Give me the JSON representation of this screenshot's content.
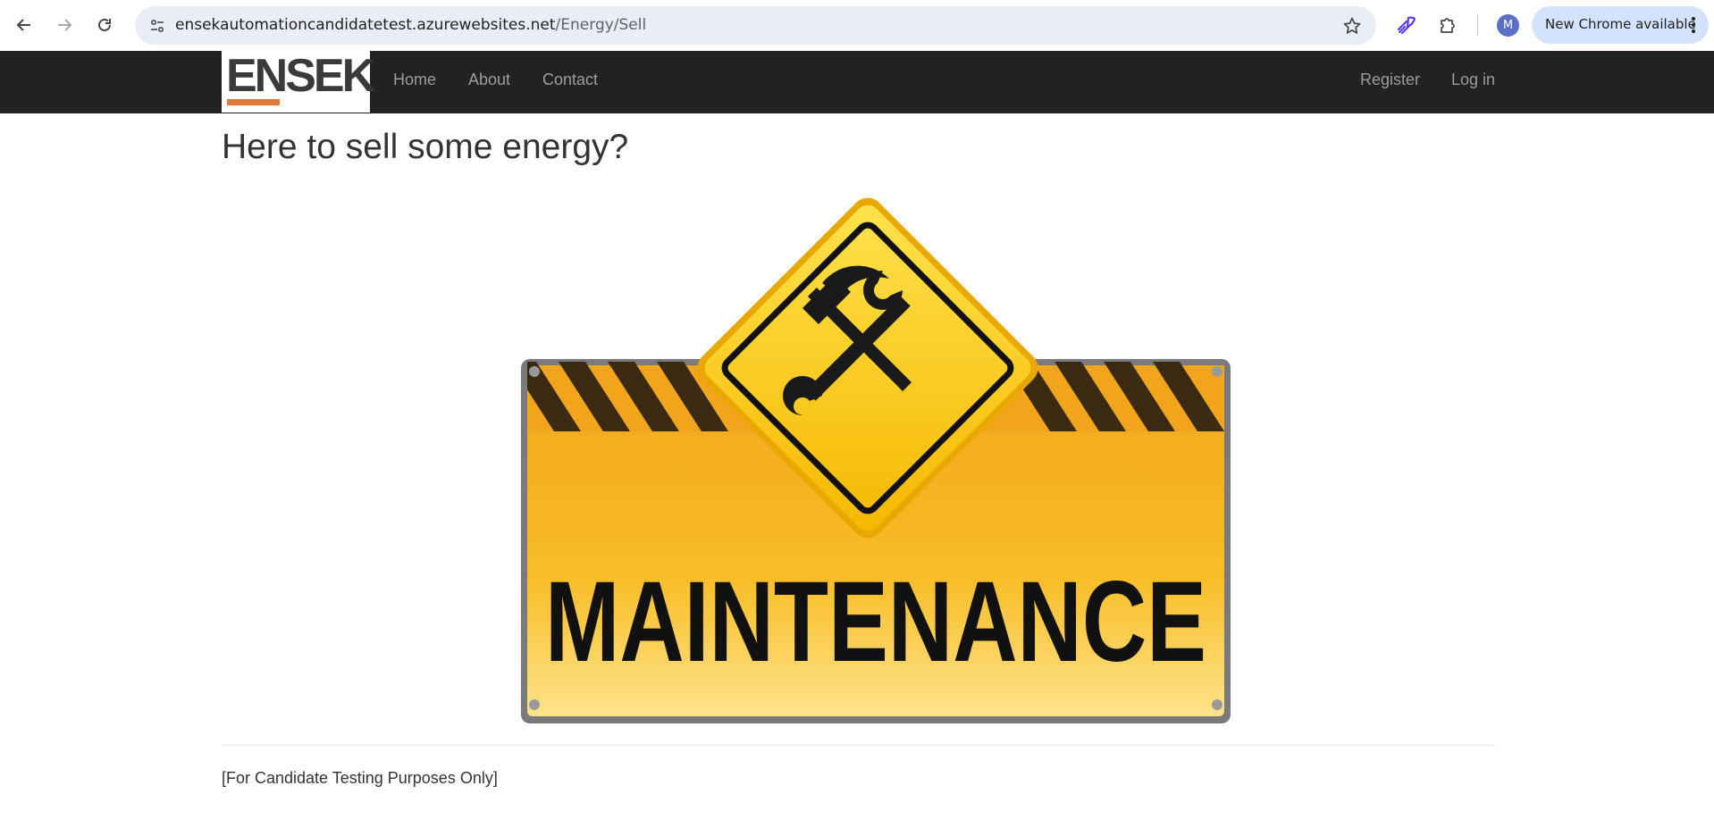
{
  "browser": {
    "url_host": "ensekautomationcandidatetest.azurewebsites.net",
    "url_path": "/Energy/Sell",
    "profile_initial": "M",
    "update_label": "New Chrome available",
    "icons": [
      "back-arrow-icon",
      "forward-arrow-icon",
      "reload-icon",
      "site-info-icon",
      "star-icon",
      "extension-rocket-icon",
      "puzzle-icon",
      "more-vert-icon"
    ]
  },
  "site": {
    "logo_text": "ENSEK",
    "nav_left": [
      "Home",
      "About",
      "Contact"
    ],
    "nav_right": [
      "Register",
      "Log in"
    ],
    "brand_accent": "#e07b39",
    "navbar_color": "#222222"
  },
  "page": {
    "title": "Here to sell some energy?",
    "maintenance_text": "MAINTENANCE",
    "footer": "[For Candidate Testing Purposes Only]"
  }
}
